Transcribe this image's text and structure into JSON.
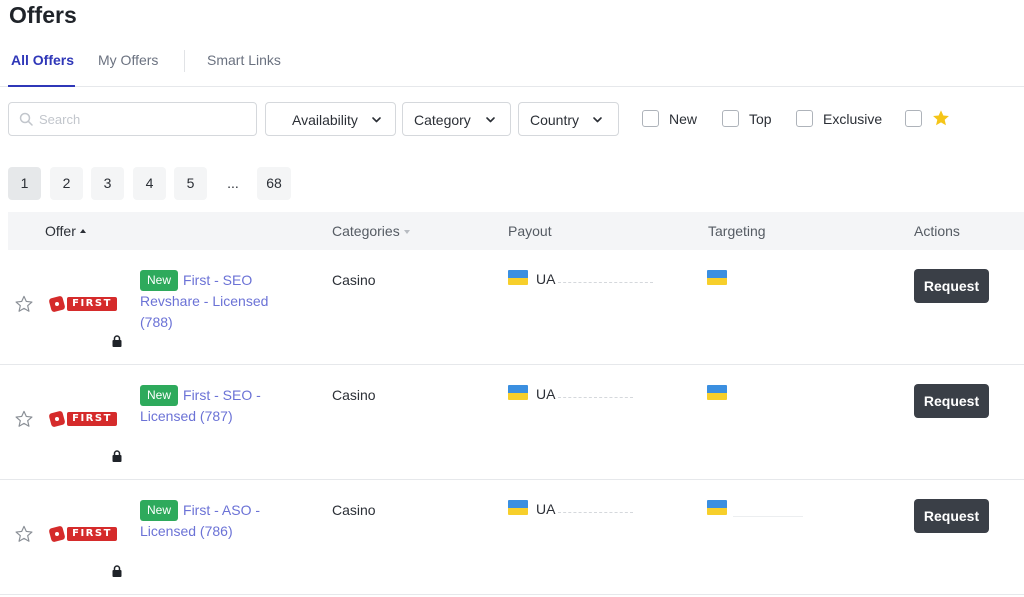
{
  "page": {
    "title": "Offers"
  },
  "tabs": [
    {
      "label": "All Offers",
      "active": true
    },
    {
      "label": "My Offers",
      "active": false
    },
    {
      "label": "Smart Links",
      "active": false
    }
  ],
  "filters": {
    "search_placeholder": "Search",
    "availability_label": "Availability",
    "category_label": "Category",
    "country_label": "Country",
    "checkboxes": [
      {
        "label": "New",
        "checked": false
      },
      {
        "label": "Top",
        "checked": false
      },
      {
        "label": "Exclusive",
        "checked": false
      },
      {
        "label": "",
        "icon": "star-icon",
        "checked": false
      }
    ]
  },
  "pagination": {
    "pages": [
      "1",
      "2",
      "3",
      "4",
      "5"
    ],
    "ellipsis": "...",
    "last": "68",
    "current": "1"
  },
  "table": {
    "columns": {
      "offer": "Offer",
      "categories": "Categories",
      "payout": "Payout",
      "targeting": "Targeting",
      "actions": "Actions"
    },
    "rows": [
      {
        "badge": "New",
        "name": "First - SEO Revshare - Licensed (788)",
        "logo_text": "FIRST",
        "category": "Casino",
        "payout_country": "UA",
        "action": "Request"
      },
      {
        "badge": "New",
        "name": "First - SEO - Licensed (787)",
        "logo_text": "FIRST",
        "category": "Casino",
        "payout_country": "UA",
        "action": "Request"
      },
      {
        "badge": "New",
        "name": "First - ASO - Licensed (786)",
        "logo_text": "FIRST",
        "category": "Casino",
        "payout_country": "UA",
        "action": "Request"
      }
    ]
  },
  "colors": {
    "accent": "#2f37b8",
    "link": "#6b72d6",
    "badge_new": "#2eaa5c",
    "button_dark": "#3a3f47",
    "logo_red": "#d52b2b",
    "flag_blue": "#3b8fe0",
    "flag_yellow": "#f7cf2b"
  }
}
